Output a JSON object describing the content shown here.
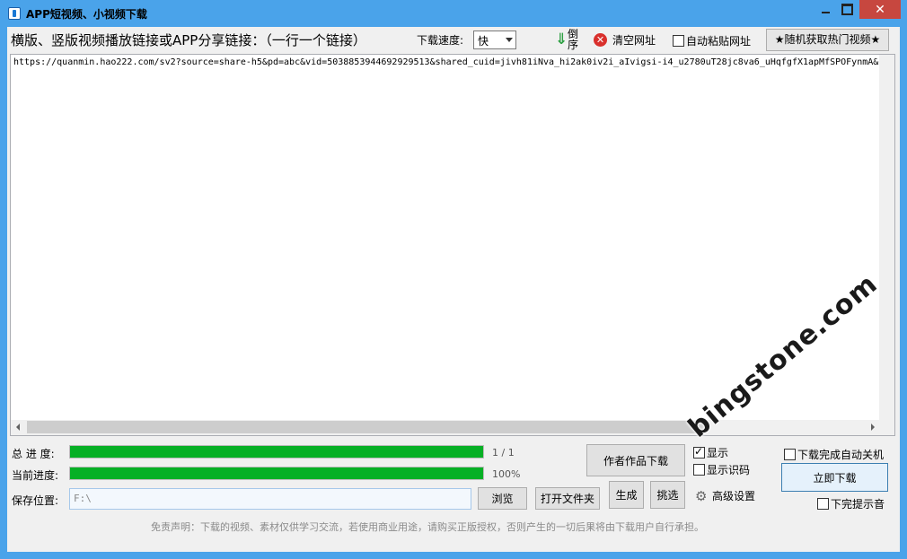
{
  "window": {
    "title": "APP短视频、小视频下载",
    "close_label": "✕"
  },
  "toolbar": {
    "main_label": "横版、竖版视频播放链接或APP分享链接：（一行一个链接）",
    "speed_label": "下载速度:",
    "speed_value": "快",
    "reverse_label": "倒序",
    "clear_label": "清空网址",
    "auto_paste_label": "自动粘贴网址",
    "auto_paste_checked": false,
    "hot_videos_label": "★随机获取热门视频★"
  },
  "url_list": {
    "lines": [
      "https://quanmin.hao222.com/sv2?source=share-h5&pd=abc&vid=5038853944692929513&shared_cuid=jivh81iNva_hi2ak0iv2i_aIvigsi-i4_u2780uT28jc8va6_uHqfgfX1apMfSPOFynmA&s"
    ]
  },
  "progress": {
    "total_label": "总 进 度:",
    "total_value": 1.0,
    "total_text": "1 / 1",
    "current_label": "当前进度:",
    "current_value": 1.0,
    "current_text": "100%"
  },
  "save": {
    "label": "保存位置:",
    "path": "F:\\",
    "browse_label": "浏览",
    "open_folder_label": "打开文件夹"
  },
  "actions": {
    "author_works_label": "作者作品下载",
    "generate_label": "生成",
    "pick_label": "挑选",
    "show_label": "显示",
    "show_checked": true,
    "ocr_label": "显示识码",
    "ocr_checked": false,
    "advanced_label": "高级设置",
    "auto_shutdown_label": "下载完成自动关机",
    "auto_shutdown_checked": false,
    "download_now_label": "立即下载",
    "done_sound_label": "下完提示音",
    "done_sound_checked": false
  },
  "disclaimer": "免责声明：下载的视频、素材仅供学习交流，若使用商业用途，请购买正版授权，否则产生的一切后果将由下载用户自行承担。",
  "watermark": "bingstone.com",
  "colors": {
    "title_bar": "#4aa3ea",
    "close_button": "#c7473f",
    "progress_fill": "#06b025",
    "clear_icon": "#d9302c",
    "reverse_arrow": "#2ea043"
  }
}
